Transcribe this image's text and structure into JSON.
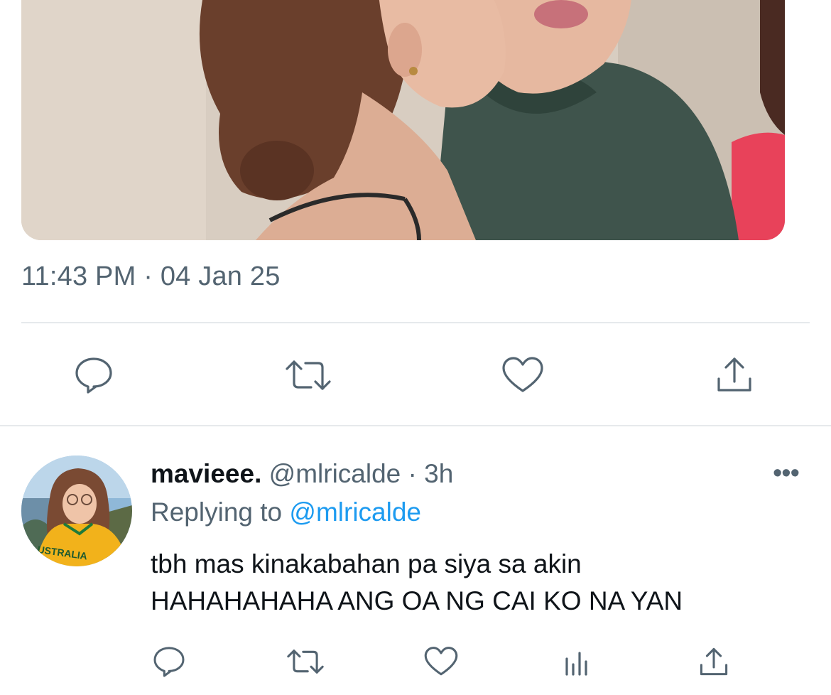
{
  "tweet": {
    "time": "11:43 PM",
    "separator": "·",
    "date": "04 Jan 25"
  },
  "tweet_actions": [
    "reply-icon",
    "retweet-icon",
    "like-icon",
    "share-icon"
  ],
  "reply": {
    "display_name": "mavieee.",
    "handle": "@mlricalde",
    "separator": "·",
    "age": "3h",
    "more": "•••",
    "replying_to_label": "Replying to",
    "replying_to_handle": "@mlricalde",
    "text_line1": "tbh mas kinakabahan pa siya sa akin",
    "text_line2": "HAHAHAHAHA ANG OA NG CAI KO NA YAN",
    "avatar_jersey_text": "USTRALIA",
    "actions": [
      "reply-icon",
      "retweet-icon",
      "like-icon",
      "views-icon",
      "share-icon"
    ]
  },
  "colors": {
    "text": "#0f1419",
    "secondary": "#536471",
    "link": "#1d9bf0",
    "divider": "#e6e9ec"
  }
}
